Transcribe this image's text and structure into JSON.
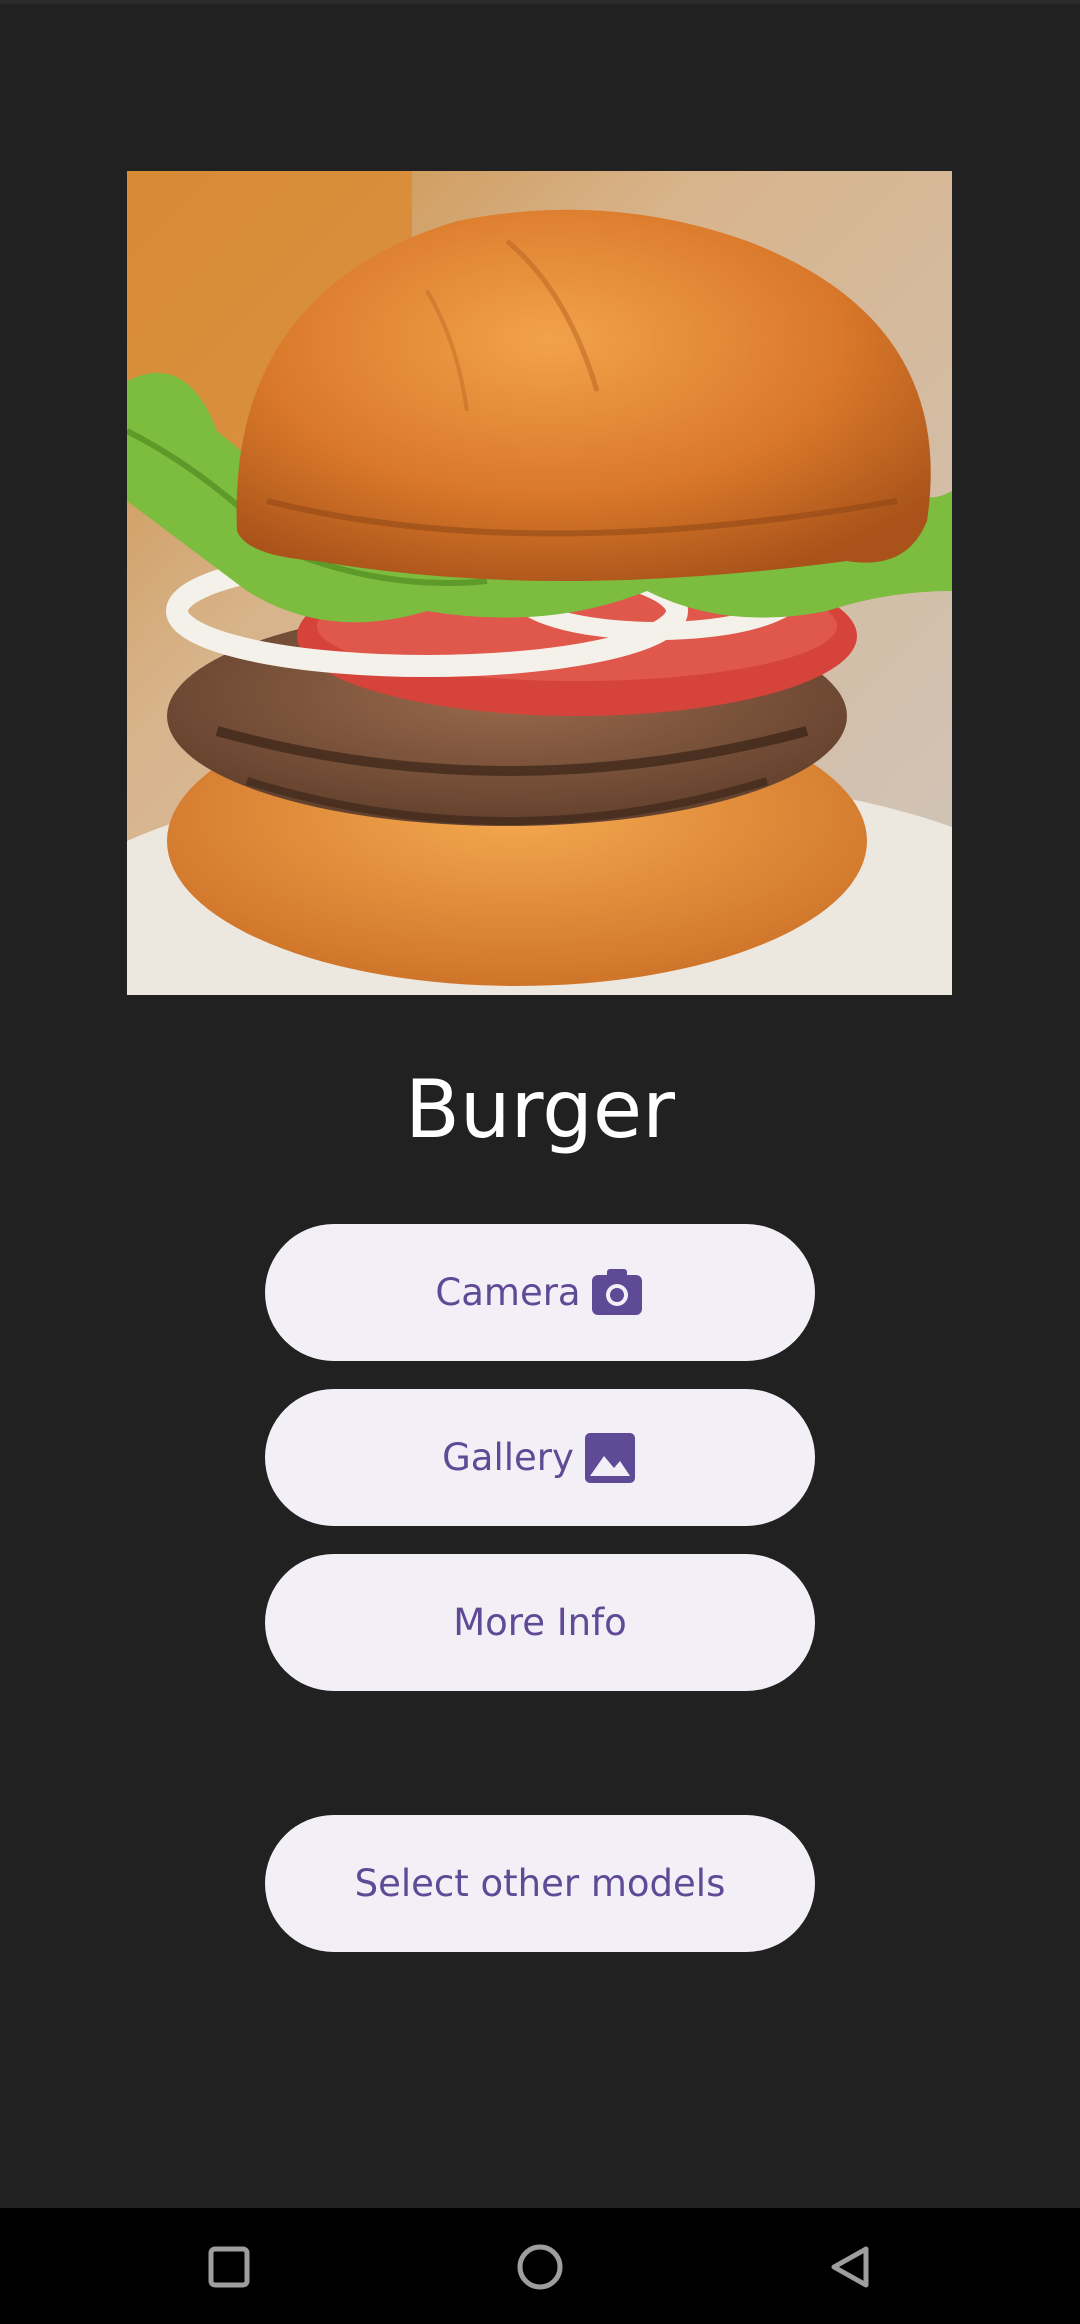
{
  "result": {
    "label": "Burger"
  },
  "image": {
    "subject": "burger photo"
  },
  "buttons": {
    "camera": {
      "label": "Camera",
      "icon": "camera-icon"
    },
    "gallery": {
      "label": "Gallery",
      "icon": "image-icon"
    },
    "more_info": {
      "label": "More Info"
    },
    "select_models": {
      "label": "Select other models"
    }
  },
  "colors": {
    "background": "#212121",
    "button_bg": "#f3eff7",
    "button_text": "#5f4a96",
    "nav_bar": "#000000"
  },
  "nav": {
    "recents_icon": "square-icon",
    "home_icon": "circle-icon",
    "back_icon": "triangle-back-icon"
  }
}
